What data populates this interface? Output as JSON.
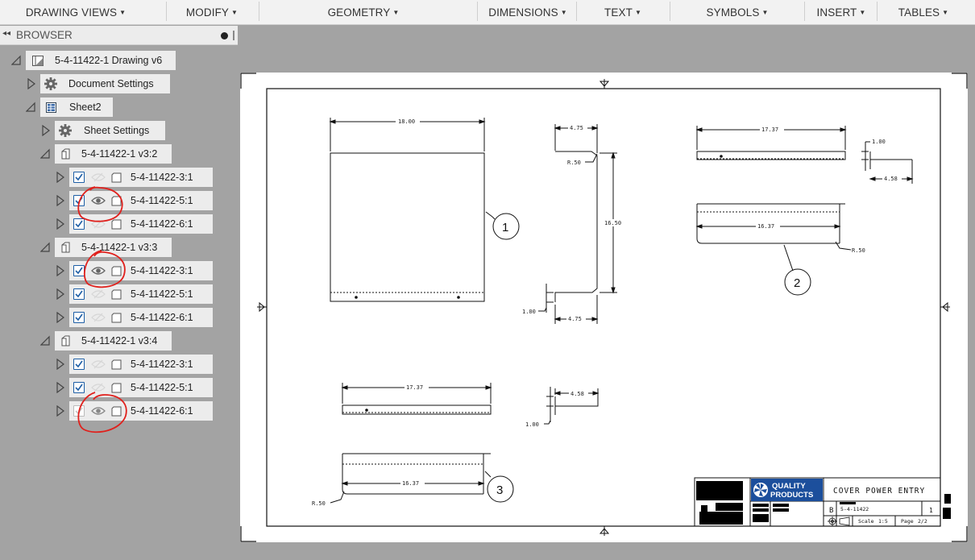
{
  "toolbar": {
    "menus": [
      {
        "label": "DRAWING VIEWS"
      },
      {
        "label": "MODIFY"
      },
      {
        "label": "GEOMETRY"
      },
      {
        "label": "DIMENSIONS"
      },
      {
        "label": "TEXT"
      },
      {
        "label": "SYMBOLS"
      },
      {
        "label": "INSERT"
      },
      {
        "label": "TABLES"
      }
    ]
  },
  "browser": {
    "title": "BROWSER",
    "root": "5-4-11422-1 Drawing v6",
    "document_settings": "Document Settings",
    "sheet": "Sheet2",
    "sheet_settings": "Sheet Settings",
    "groups": [
      {
        "label": "5-4-11422-1 v3:2",
        "items": [
          {
            "label": "5-4-11422-3:1",
            "checked": true,
            "visible": false
          },
          {
            "label": "5-4-11422-5:1",
            "checked": true,
            "visible": true
          },
          {
            "label": "5-4-11422-6:1",
            "checked": true,
            "visible": false
          }
        ]
      },
      {
        "label": "5-4-11422-1 v3:3",
        "items": [
          {
            "label": "5-4-11422-3:1",
            "checked": true,
            "visible": true
          },
          {
            "label": "5-4-11422-5:1",
            "checked": true,
            "visible": false
          },
          {
            "label": "5-4-11422-6:1",
            "checked": true,
            "visible": false
          }
        ]
      },
      {
        "label": "5-4-11422-1 v3:4",
        "items": [
          {
            "label": "5-4-11422-3:1",
            "checked": true,
            "visible": false
          },
          {
            "label": "5-4-11422-5:1",
            "checked": true,
            "visible": false
          },
          {
            "label": "5-4-11422-6:1",
            "checked": true,
            "visible": true
          }
        ]
      }
    ]
  },
  "drawing": {
    "view1": {
      "width_dim": "18.00",
      "balloon": "1"
    },
    "view2": {
      "top_dim": "4.75",
      "radius": "R.50",
      "height_dim": "16.50",
      "flange_dim": "1.00",
      "bottom_dim": "4.75"
    },
    "view3": {
      "width_dim": "17.37",
      "lower_dim": "16.37",
      "radius": "R.50",
      "balloon": "2"
    },
    "view4": {
      "flange_dim": "1.00",
      "length_dim": "4.58"
    },
    "view5": {
      "width_dim": "17.37"
    },
    "view6": {
      "flange_dim": "1.00",
      "length_dim": "4.58"
    },
    "view7": {
      "lower_dim": "16.37",
      "radius": "R.50",
      "balloon": "3"
    },
    "title_block": {
      "company_line1": "QUALITY",
      "company_line2": "PRODUCTS",
      "title": "COVER POWER ENTRY",
      "size": "B",
      "part_number": "5-4-11422",
      "revision": "1",
      "scale_label": "Scale",
      "scale": "1:5",
      "page_label": "Page",
      "page": "2/2"
    }
  },
  "colors": {
    "toolbar_bg": "#f2f2f2",
    "panel_bg": "#ececec",
    "canvas_bg": "#a3a3a3",
    "checkbox": "#1d5ea5",
    "markup_red": "#e0201c",
    "logo_blue": "#1c4f9c"
  }
}
